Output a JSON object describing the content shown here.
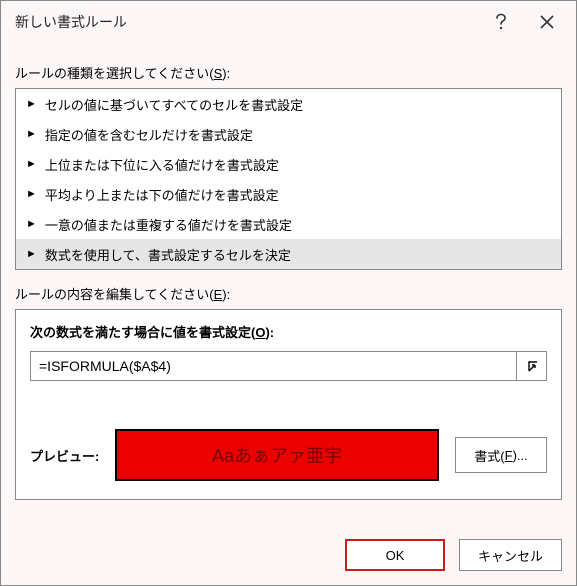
{
  "titlebar": {
    "title": "新しい書式ルール"
  },
  "labels": {
    "rule_type_prefix": "ルールの種類を選択してください(",
    "rule_type_key": "S",
    "rule_type_suffix": "):",
    "rule_edit_prefix": "ルールの内容を編集してください(",
    "rule_edit_key": "E",
    "rule_edit_suffix": "):",
    "formula_title_prefix": "次の数式を満たす場合に値を書式設定(",
    "formula_title_key": "O",
    "formula_title_suffix": "):",
    "preview": "プレビュー:",
    "format_btn_prefix": "書式(",
    "format_btn_key": "F",
    "format_btn_suffix": ")..."
  },
  "rule_types": {
    "items": [
      {
        "label": "セルの値に基づいてすべてのセルを書式設定"
      },
      {
        "label": "指定の値を含むセルだけを書式設定"
      },
      {
        "label": "上位または下位に入る値だけを書式設定"
      },
      {
        "label": "平均より上または下の値だけを書式設定"
      },
      {
        "label": "一意の値または重複する値だけを書式設定"
      },
      {
        "label": "数式を使用して、書式設定するセルを決定"
      }
    ],
    "selected_index": 5
  },
  "formula": {
    "value": "=ISFORMULA($A$4)"
  },
  "preview": {
    "sample_text": "Aaあぁアァ亜宇"
  },
  "footer": {
    "ok": "OK",
    "cancel": "キャンセル"
  }
}
